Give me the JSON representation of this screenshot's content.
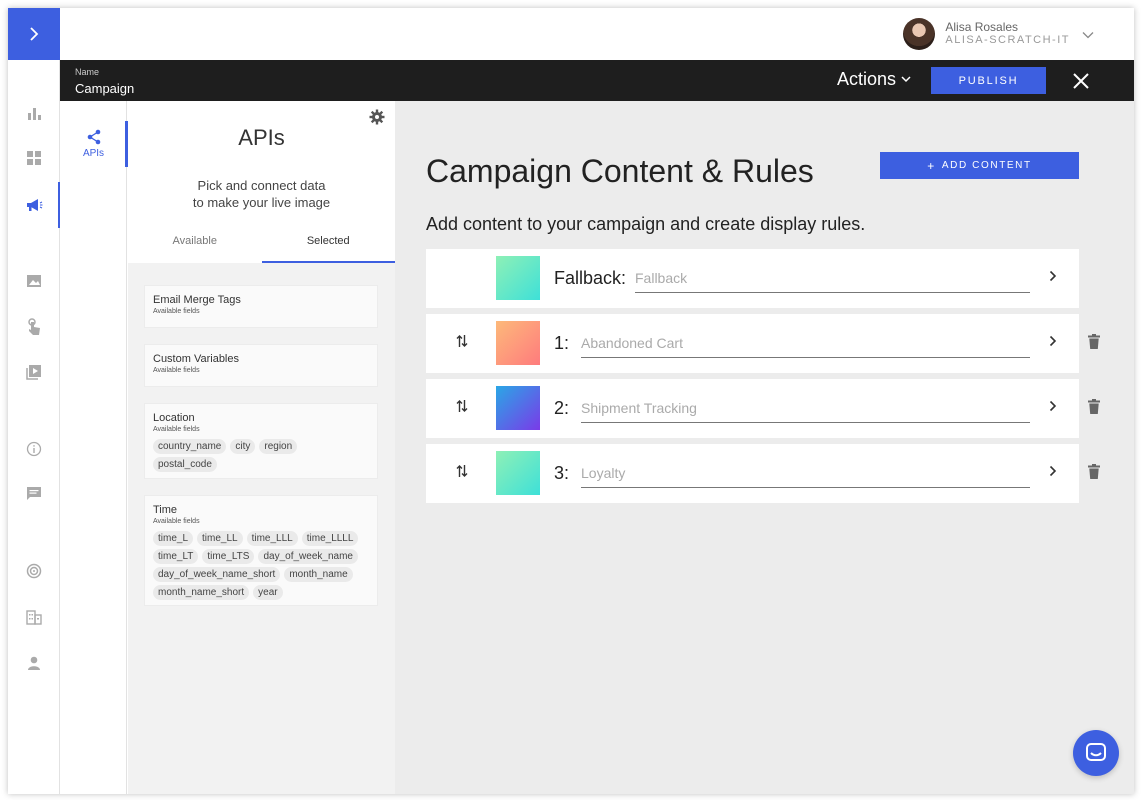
{
  "user": {
    "name": "Alisa Rosales",
    "org": "ALISA-SCRATCH-IT"
  },
  "header": {
    "name_label": "Name",
    "name_value": "Campaign",
    "actions_label": "Actions",
    "publish_label": "PUBLISH"
  },
  "rail": {
    "icons": [
      "expand-icon",
      "bar-chart-icon",
      "dashboard-icon",
      "megaphone-icon",
      "image-icon",
      "touch-icon",
      "video-library-icon",
      "info-icon",
      "chat-icon",
      "target-icon",
      "building-icon",
      "person-icon"
    ],
    "active": "megaphone-icon"
  },
  "api_panel": {
    "tab_label": "APIs",
    "title": "APIs",
    "subtitle_line1": "Pick and connect data",
    "subtitle_line2": "to make your live image",
    "tabs": [
      "Available",
      "Selected"
    ],
    "selected_tab": "Selected",
    "cards": [
      {
        "title": "Email Merge Tags",
        "sub": "Available fields",
        "fields": []
      },
      {
        "title": "Custom Variables",
        "sub": "Available fields",
        "fields": []
      },
      {
        "title": "Location",
        "sub": "Available fields",
        "fields": [
          "country_name",
          "city",
          "region",
          "postal_code"
        ]
      },
      {
        "title": "Time",
        "sub": "Available fields",
        "fields": [
          "time_L",
          "time_LL",
          "time_LLL",
          "time_LLLL",
          "time_LT",
          "time_LTS",
          "day_of_week_name",
          "day_of_week_name_short",
          "month_name",
          "month_name_short",
          "year"
        ]
      }
    ]
  },
  "main": {
    "title": "Campaign Content & Rules",
    "add_content_label": "ADD CONTENT",
    "description": "Add content to your campaign and create display rules.",
    "rules": [
      {
        "num": "Fallback:",
        "value": "Fallback",
        "gradient": [
          "#8ef0b6",
          "#3ee0d8"
        ],
        "draggable": false
      },
      {
        "num": "1:",
        "value": "Abandoned Cart",
        "gradient": [
          "#fdb97a",
          "#fe7b7d"
        ],
        "draggable": true
      },
      {
        "num": "2:",
        "value": "Shipment Tracking",
        "gradient": [
          "#2aa7e6",
          "#7a3ae8"
        ],
        "draggable": true
      },
      {
        "num": "3:",
        "value": "Loyalty",
        "gradient": [
          "#8ef0b6",
          "#3ee0d8"
        ],
        "draggable": true
      }
    ]
  },
  "colors": {
    "accent": "#3d5fe0",
    "dark_bar": "#1e1e1e",
    "main_bg": "#ececec"
  }
}
